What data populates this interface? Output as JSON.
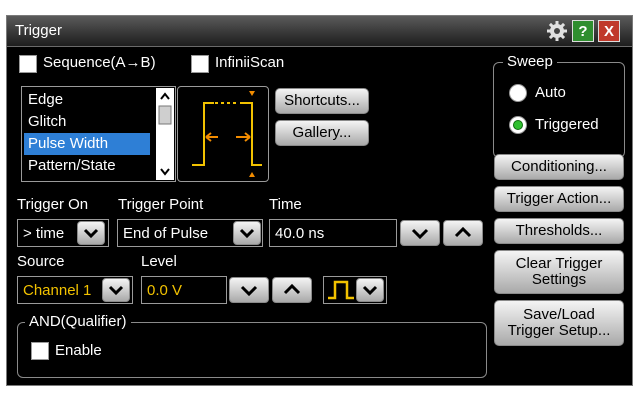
{
  "window": {
    "title": "Trigger"
  },
  "titlebar": {
    "help_label": "?",
    "close_label": "X"
  },
  "options": {
    "sequence_label": "Sequence(A→B)",
    "infiniiscan_label": "InfiniiScan"
  },
  "trigger_types": {
    "items": [
      "Edge",
      "Glitch",
      "Pulse Width",
      "Pattern/State"
    ],
    "selected": "Pulse Width"
  },
  "buttons": {
    "shortcuts": "Shortcuts...",
    "gallery": "Gallery..."
  },
  "trigger_on": {
    "label": "Trigger On",
    "value": "> time"
  },
  "trigger_point": {
    "label": "Trigger Point",
    "value": "End of Pulse"
  },
  "time": {
    "label": "Time",
    "value": "40.0 ns"
  },
  "source": {
    "label": "Source",
    "value": "Channel 1"
  },
  "level": {
    "label": "Level",
    "value": "0.0 V"
  },
  "qualifier": {
    "label": "AND(Qualifier)",
    "enable_label": "Enable"
  },
  "sweep": {
    "label": "Sweep",
    "auto_label": "Auto",
    "triggered_label": "Triggered",
    "selected": "Triggered"
  },
  "side_buttons": {
    "conditioning": "Conditioning...",
    "trigger_action": "Trigger Action...",
    "thresholds": "Thresholds...",
    "clear_line1": "Clear Trigger",
    "clear_line2": "Settings",
    "save_line1": "Save/Load",
    "save_line2": "Trigger Setup..."
  },
  "colors": {
    "accent_yellow": "#f2c200",
    "selection_blue": "#2e7fd6",
    "arrow_orange": "#f28c00",
    "triggered_green": "#2fbf2f"
  },
  "icons": [
    "gear-icon",
    "help-icon",
    "close-icon",
    "chevron-down-icon",
    "chevron-up-icon",
    "pulse-polarity-icon"
  ]
}
